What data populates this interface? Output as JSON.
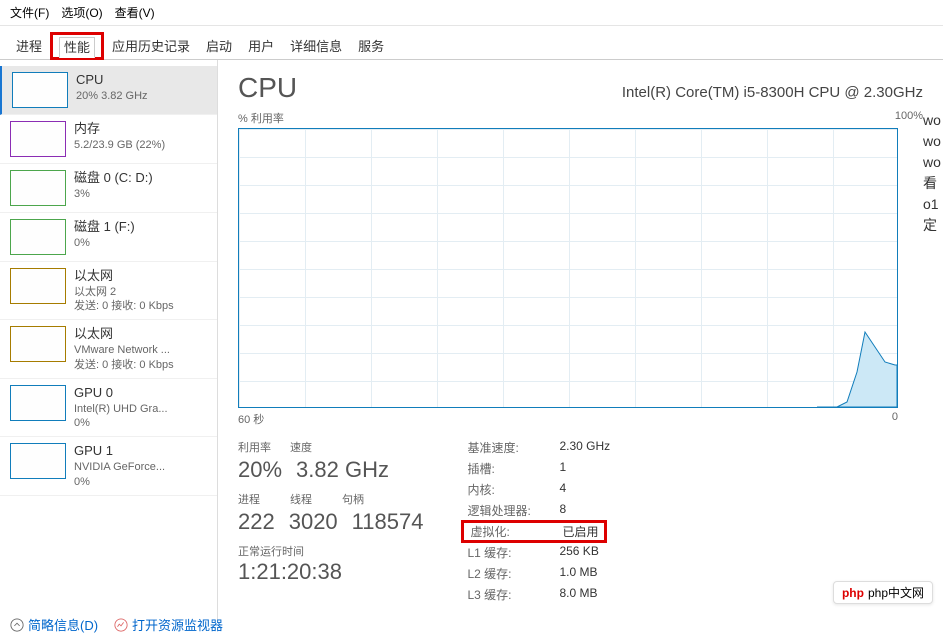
{
  "menubar": {
    "file": "文件(F)",
    "options": "选项(O)",
    "view": "查看(V)"
  },
  "tabs": {
    "processes": "进程",
    "performance": "性能",
    "app_history": "应用历史记录",
    "startup": "启动",
    "users": "用户",
    "details": "详细信息",
    "services": "服务"
  },
  "sidebar": [
    {
      "title": "CPU",
      "sub": "20% 3.82 GHz",
      "color": "#117dbb",
      "selected": true
    },
    {
      "title": "内存",
      "sub": "5.2/23.9 GB (22%)",
      "color": "#8b2db4",
      "selected": false
    },
    {
      "title": "磁盘 0 (C: D:)",
      "sub": "3%",
      "color": "#4ca64c",
      "selected": false
    },
    {
      "title": "磁盘 1 (F:)",
      "sub": "0%",
      "color": "#4ca64c",
      "selected": false
    },
    {
      "title": "以太网",
      "sub": "以太网 2",
      "sub2": "发送: 0 接收: 0 Kbps",
      "color": "#a67c00",
      "selected": false
    },
    {
      "title": "以太网",
      "sub": "VMware Network ...",
      "sub2": "发送: 0 接收: 0 Kbps",
      "color": "#a67c00",
      "selected": false
    },
    {
      "title": "GPU 0",
      "sub": "Intel(R) UHD Gra...",
      "sub2": "0%",
      "color": "#117dbb",
      "selected": false
    },
    {
      "title": "GPU 1",
      "sub": "NVIDIA GeForce...",
      "sub2": "0%",
      "color": "#117dbb",
      "selected": false
    }
  ],
  "header": {
    "title": "CPU",
    "model": "Intel(R) Core(TM) i5-8300H CPU @ 2.30GHz"
  },
  "chart": {
    "y_label": "% 利用率",
    "y_max": "100%",
    "x_label": "60 秒",
    "x_end": "0"
  },
  "chart_data": {
    "type": "line",
    "title": "% 利用率",
    "xlabel": "60 秒",
    "ylabel": "%",
    "ylim": [
      0,
      100
    ],
    "x": [
      60,
      55,
      50,
      45,
      40,
      35,
      30,
      25,
      20,
      15,
      10,
      8,
      6,
      5,
      4,
      3,
      2,
      1,
      0
    ],
    "values": [
      0,
      0,
      0,
      0,
      0,
      0,
      0,
      0,
      0,
      0,
      0,
      0,
      2,
      8,
      22,
      31,
      26,
      20,
      20
    ]
  },
  "stats_left": {
    "util_label": "利用率",
    "util_val": "20%",
    "speed_label": "速度",
    "speed_val": "3.82 GHz",
    "proc_label": "进程",
    "proc_val": "222",
    "thread_label": "线程",
    "thread_val": "3020",
    "handle_label": "句柄",
    "handle_val": "118574",
    "uptime_label": "正常运行时间",
    "uptime_val": "1:21:20:38"
  },
  "stats_right": {
    "base_speed_label": "基准速度:",
    "base_speed_val": "2.30 GHz",
    "sockets_label": "插槽:",
    "sockets_val": "1",
    "cores_label": "内核:",
    "cores_val": "4",
    "logical_label": "逻辑处理器:",
    "logical_val": "8",
    "virt_label": "虚拟化:",
    "virt_val": "已启用",
    "l1_label": "L1 缓存:",
    "l1_val": "256 KB",
    "l2_label": "L2 缓存:",
    "l2_val": "1.0 MB",
    "l3_label": "L3 缓存:",
    "l3_val": "8.0 MB"
  },
  "footer": {
    "brief": "简略信息(D)",
    "resmon": "打开资源监视器"
  },
  "side_text": [
    "wo",
    "wo",
    "wo",
    "看",
    "o1",
    "定"
  ],
  "badge": "php中文网"
}
